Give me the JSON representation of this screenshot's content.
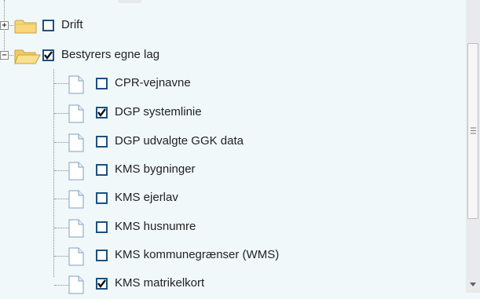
{
  "tree": {
    "groups": [
      {
        "label": "Drift",
        "expanded": false,
        "checked": false
      },
      {
        "label": "Bestyrers egne lag",
        "expanded": true,
        "checked": true
      }
    ],
    "layers": [
      {
        "label": "CPR-vejnavne",
        "checked": false
      },
      {
        "label": "DGP systemlinie",
        "checked": true
      },
      {
        "label": "DGP udvalgte GGK data",
        "checked": false
      },
      {
        "label": "KMS bygninger",
        "checked": false
      },
      {
        "label": "KMS ejerlav",
        "checked": false
      },
      {
        "label": "KMS husnumre",
        "checked": false
      },
      {
        "label": "KMS kommunegrænser (WMS)",
        "checked": false
      },
      {
        "label": "KMS matrikelkort",
        "checked": true
      }
    ]
  },
  "colors": {
    "background": "#f0f8fa",
    "checkbox_border": "#1c5180",
    "folder": "#f7d77a"
  },
  "icons": {
    "expand": "plus-box-icon",
    "collapse": "minus-box-icon",
    "group": "folder-icon",
    "layer": "document-icon"
  }
}
